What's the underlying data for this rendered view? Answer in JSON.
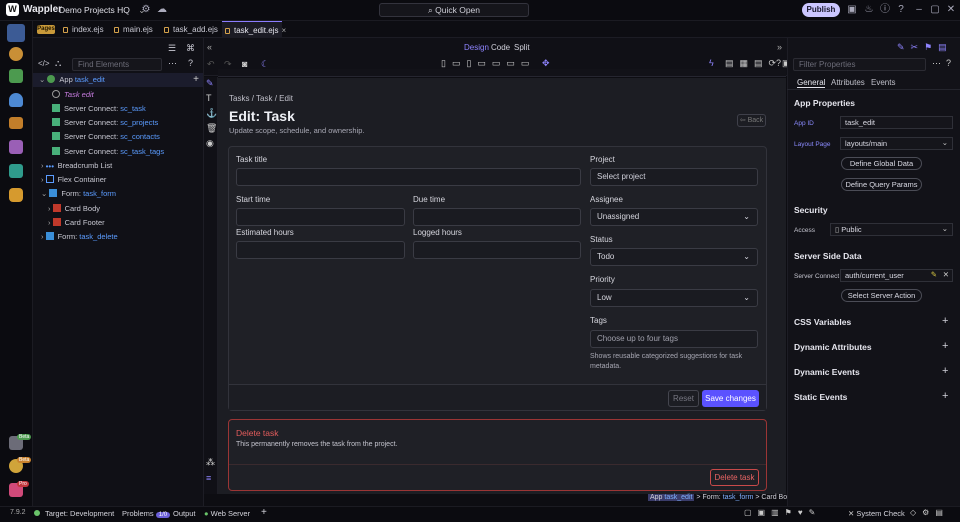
{
  "app": {
    "name": "Wappler",
    "project": "Demo Projects HQ",
    "quick_open": "Quick Open",
    "publish": "Publish"
  },
  "file_tabs": {
    "pages_chip": "Pages",
    "tabs": [
      {
        "label": "index.ejs"
      },
      {
        "label": "main.ejs"
      },
      {
        "label": "task_add.ejs"
      },
      {
        "label": "task_edit.ejs"
      }
    ],
    "close": "×"
  },
  "left_panel": {
    "find_placeholder": "Find Elements",
    "tree": [
      {
        "prefix": "App",
        "name": "task_edit"
      },
      {
        "prefix": "Task edit",
        "name": ""
      },
      {
        "prefix": "Server Connect:",
        "name": "sc_task"
      },
      {
        "prefix": "Server Connect:",
        "name": "sc_projects"
      },
      {
        "prefix": "Server Connect:",
        "name": "sc_contacts"
      },
      {
        "prefix": "Server Connect:",
        "name": "sc_task_tags"
      },
      {
        "prefix": "Breadcrumb List",
        "name": ""
      },
      {
        "prefix": "Flex Container",
        "name": ""
      },
      {
        "prefix": "Form:",
        "name": "task_form"
      },
      {
        "prefix": "Card Body",
        "name": ""
      },
      {
        "prefix": "Card Footer",
        "name": ""
      },
      {
        "prefix": "Form:",
        "name": "task_delete"
      }
    ]
  },
  "design_bar": {
    "tabs": [
      "Design",
      "Code",
      "Split"
    ]
  },
  "canvas": {
    "breadcrumb": {
      "a": "Tasks",
      "b": "Task",
      "c": "Edit",
      "sep": "/"
    },
    "title": "Edit: Task",
    "subtitle": "Update scope, schedule, and ownership.",
    "back": "Back",
    "fields": {
      "task_title": "Task title",
      "start_time": "Start time",
      "due_time": "Due time",
      "estimated_hours": "Estimated hours",
      "logged_hours": "Logged hours",
      "project": "Project",
      "project_value": "Select project",
      "assignee": "Assignee",
      "assignee_value": "Unassigned",
      "status": "Status",
      "status_value": "Todo",
      "priority": "Priority",
      "priority_value": "Low",
      "tags": "Tags",
      "tags_placeholder": "Choose up to four tags",
      "tags_help": "Shows reusable categorized suggestions for task metadata."
    },
    "reset": "Reset",
    "save": "Save changes",
    "delete_card": {
      "title": "Delete task",
      "text": "This permanently removes the task from the project.",
      "button": "Delete task"
    }
  },
  "path_bar": {
    "app": "App",
    "app_name": "task_edit",
    "sep": ">",
    "form": "Form:",
    "form_name": "task_form",
    "body": "Card Body"
  },
  "right_panel": {
    "filter_placeholder": "Filter Properties",
    "tabs": [
      "General",
      "Attributes",
      "Events"
    ],
    "app_properties": "App Properties",
    "app_id_label": "App ID",
    "app_id": "task_edit",
    "layout_label": "Layout Page",
    "layout": "layouts/main",
    "define_global": "Define Global Data",
    "define_query": "Define Query Params",
    "security": "Security",
    "access_label": "Access",
    "access": "Public",
    "server_side": "Server Side Data",
    "sc_label": "Server Connect",
    "sc_value": "auth/current_user",
    "select_action": "Select Server Action",
    "sections": [
      "CSS Variables",
      "Dynamic Attributes",
      "Dynamic Events",
      "Static Events"
    ]
  },
  "status_bar": {
    "version": "7.9.2",
    "target": "Target:",
    "target_value": "Development",
    "problems": "Problems",
    "problems_count": "1/0",
    "output": "Output",
    "web_server": "Web Server",
    "system_check": "System Check"
  },
  "badges": {
    "beta": "Beta",
    "pro": "Pro"
  }
}
